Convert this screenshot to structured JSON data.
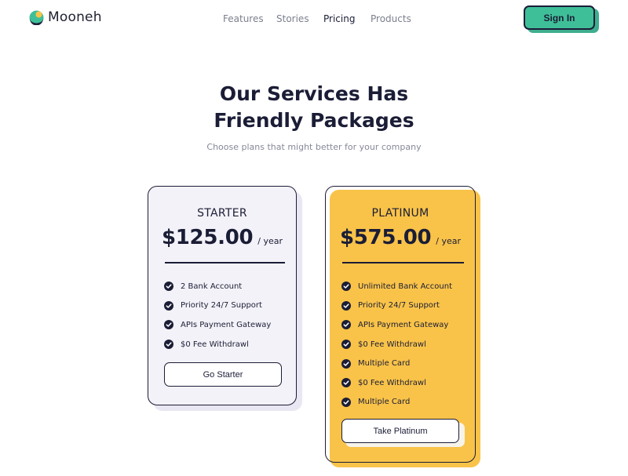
{
  "brand": {
    "name": "Mooneh",
    "icon": "moon-logo-icon"
  },
  "nav": {
    "items": [
      {
        "label": "Features",
        "active": false
      },
      {
        "label": "Stories",
        "active": false
      },
      {
        "label": "Pricing",
        "active": true
      },
      {
        "label": "Products",
        "active": false
      }
    ],
    "signin_label": "Sign In"
  },
  "hero": {
    "title_line1": "Our Services Has",
    "title_line2": "Friendly Packages",
    "subtitle": "Choose plans that might better for your company"
  },
  "plans": [
    {
      "name": "STARTER",
      "price": "$125.00",
      "period": "/ year",
      "features": [
        "2 Bank Account",
        "Priority 24/7 Support",
        "APIs Payment Gateway",
        "$0 Fee Withdrawl"
      ],
      "cta": "Go Starter"
    },
    {
      "name": "PLATINUM",
      "price": "$575.00",
      "period": "/ year",
      "features": [
        "Unlimited Bank Account",
        "Priority 24/7 Support",
        "APIs Payment Gateway",
        "$0 Fee Withdrawl",
        "Multiple Card",
        "$0 Fee Withdrawl",
        "Multiple Card"
      ],
      "cta": "Take Platinum"
    }
  ],
  "colors": {
    "accent": "#3fbf98",
    "ink": "#1b1d36",
    "platinum_bg": "#f9c349",
    "starter_bg": "#f3f2f8"
  }
}
